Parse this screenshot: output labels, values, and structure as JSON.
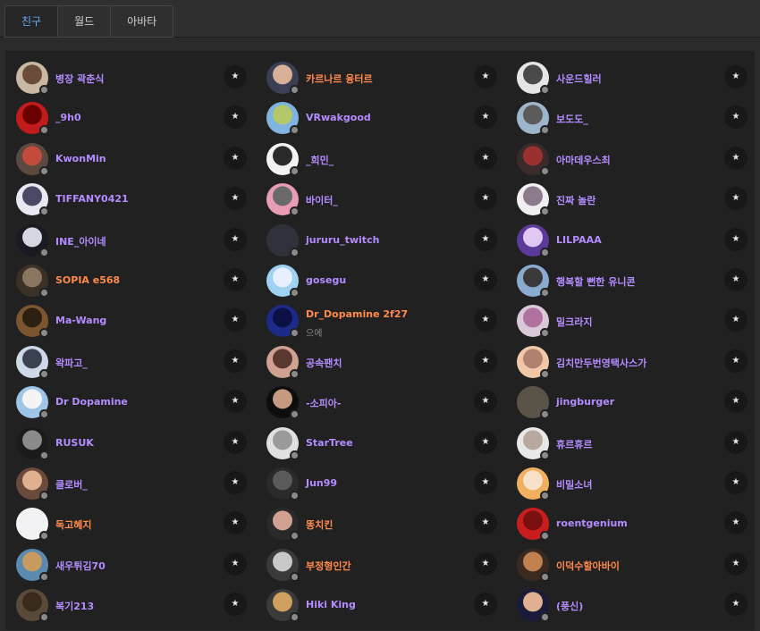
{
  "tabs": [
    "친구",
    "월드",
    "아바타"
  ],
  "active_tab": 0,
  "star_glyph": "★",
  "colors": {
    "purple": "#b48cff",
    "orange": "#ff8a4c",
    "active_tab": "#6ab0f3"
  },
  "friends": [
    {
      "name": "병장 곽춘식",
      "color": "#b48cff",
      "av": [
        "#c9b8a3",
        "#6b4b3a"
      ]
    },
    {
      "name": "카르나르 융터르",
      "color": "#ff8a4c",
      "av": [
        "#3b3f55",
        "#d7b197"
      ]
    },
    {
      "name": "사운드힐러",
      "color": "#b48cff",
      "av": [
        "#e5e5e5",
        "#4a4a4a"
      ]
    },
    {
      "name": "_9h0",
      "color": "#b48cff",
      "av": [
        "#c21b1b",
        "#6b0000"
      ]
    },
    {
      "name": "VRwakgood",
      "color": "#b48cff",
      "av": [
        "#7fb3e0",
        "#b4c86a"
      ]
    },
    {
      "name": "보도도_",
      "color": "#b48cff",
      "av": [
        "#9eb6cc",
        "#5b5b5b"
      ]
    },
    {
      "name": "KwonMin",
      "color": "#b48cff",
      "av": [
        "#5c4a40",
        "#c34b3b"
      ]
    },
    {
      "name": "_희민_",
      "color": "#b48cff",
      "av": [
        "#f2f2f2",
        "#2a2a2a"
      ]
    },
    {
      "name": "아마데우스최",
      "color": "#b48cff",
      "av": [
        "#3b2b2b",
        "#9a3030"
      ]
    },
    {
      "name": "TIFFANY0421",
      "color": "#b48cff",
      "av": [
        "#e8e8f0",
        "#4a4a66"
      ]
    },
    {
      "name": "바이터_",
      "color": "#b48cff",
      "av": [
        "#e89db4",
        "#6a6a6a"
      ]
    },
    {
      "name": "진짜 놀란",
      "color": "#b48cff",
      "av": [
        "#f0eef0",
        "#8a7a8a"
      ]
    },
    {
      "name": "INE_아이네",
      "color": "#b48cff",
      "av": [
        "#1a1a22",
        "#d6d6e0"
      ]
    },
    {
      "name": "jururu_twitch",
      "color": "#b48cff",
      "av": [
        "#2f323a",
        "#2f323a"
      ]
    },
    {
      "name": "LILPAAA",
      "color": "#b48cff",
      "av": [
        "#5b3a9a",
        "#e0c8f0"
      ]
    },
    {
      "name": "SOPIA e568",
      "color": "#ff8a4c",
      "av": [
        "#3b3127",
        "#8a7560"
      ]
    },
    {
      "name": "gosegu",
      "color": "#b48cff",
      "av": [
        "#9fd2f0",
        "#e8f0ff"
      ]
    },
    {
      "name": "행복할 뻔한 유니콘",
      "color": "#b48cff",
      "av": [
        "#8aaad0",
        "#3a3a3a"
      ]
    },
    {
      "name": "Ma-Wang",
      "color": "#b48cff",
      "av": [
        "#7a5530",
        "#2d2010"
      ]
    },
    {
      "name": "Dr_Dopamine 2f27",
      "color": "#ff8a4c",
      "sub": "으에",
      "av": [
        "#1c2a8a",
        "#0c1045"
      ]
    },
    {
      "name": "밀크라지",
      "color": "#b48cff",
      "av": [
        "#d8c8d8",
        "#b070a0"
      ]
    },
    {
      "name": "왁파고_",
      "color": "#b48cff",
      "av": [
        "#cfd8e8",
        "#3a4250"
      ]
    },
    {
      "name": "공속팬치",
      "color": "#b48cff",
      "av": [
        "#d0a090",
        "#5a3a30"
      ]
    },
    {
      "name": "김치만두번영택사스가",
      "color": "#b48cff",
      "av": [
        "#f0c8a8",
        "#b08070"
      ]
    },
    {
      "name": "Dr Dopamine",
      "color": "#b48cff",
      "av": [
        "#9ec4e8",
        "#f4f4f4"
      ]
    },
    {
      "name": "-소피아-",
      "color": "#b48cff",
      "av": [
        "#0d0d0d",
        "#c49a80"
      ]
    },
    {
      "name": "jingburger",
      "color": "#b48cff",
      "av": [
        "#5a5448",
        "#5a5448"
      ]
    },
    {
      "name": "RUSUK",
      "color": "#b48cff",
      "av": [
        "#1a1a1a",
        "#8a8a8a"
      ]
    },
    {
      "name": "StarTree",
      "color": "#b48cff",
      "av": [
        "#e0e0e0",
        "#9a9a9a"
      ]
    },
    {
      "name": "휴르휴르",
      "color": "#b48cff",
      "av": [
        "#e8e8e8",
        "#b8a8a0"
      ]
    },
    {
      "name": "클로버_",
      "color": "#b48cff",
      "av": [
        "#6a4a3a",
        "#e0b090"
      ]
    },
    {
      "name": "Jun99",
      "color": "#b48cff",
      "av": [
        "#2a2a2a",
        "#5a5a5a"
      ]
    },
    {
      "name": "비밀소녀",
      "color": "#b48cff",
      "av": [
        "#f0b060",
        "#f8e0c8"
      ]
    },
    {
      "name": "독고혜지",
      "color": "#ff8a4c",
      "av": [
        "#f2f2f4",
        "#f2f2f4"
      ]
    },
    {
      "name": "똥치킨",
      "color": "#ff8a4c",
      "av": [
        "#2a2a2a",
        "#d0a090"
      ]
    },
    {
      "name": "roentgenium",
      "color": "#b48cff",
      "av": [
        "#c81e1e",
        "#7a1010"
      ]
    },
    {
      "name": "새우튀김70",
      "color": "#b48cff",
      "av": [
        "#5a8ab0",
        "#c89a60"
      ]
    },
    {
      "name": "부정형인간",
      "color": "#ff8a4c",
      "av": [
        "#3a3a3a",
        "#c8c8c8"
      ]
    },
    {
      "name": "이덕수할아바이",
      "color": "#ff8a4c",
      "av": [
        "#3a2a20",
        "#c08050"
      ]
    },
    {
      "name": "복기213",
      "color": "#b48cff",
      "av": [
        "#5a4a3a",
        "#3a2a1a"
      ]
    },
    {
      "name": "Hiki King",
      "color": "#b48cff",
      "av": [
        "#3a3a3a",
        "#d0a060"
      ]
    },
    {
      "name": "(풍신)",
      "color": "#b48cff",
      "av": [
        "#1a1a3a",
        "#e0b090"
      ]
    }
  ]
}
